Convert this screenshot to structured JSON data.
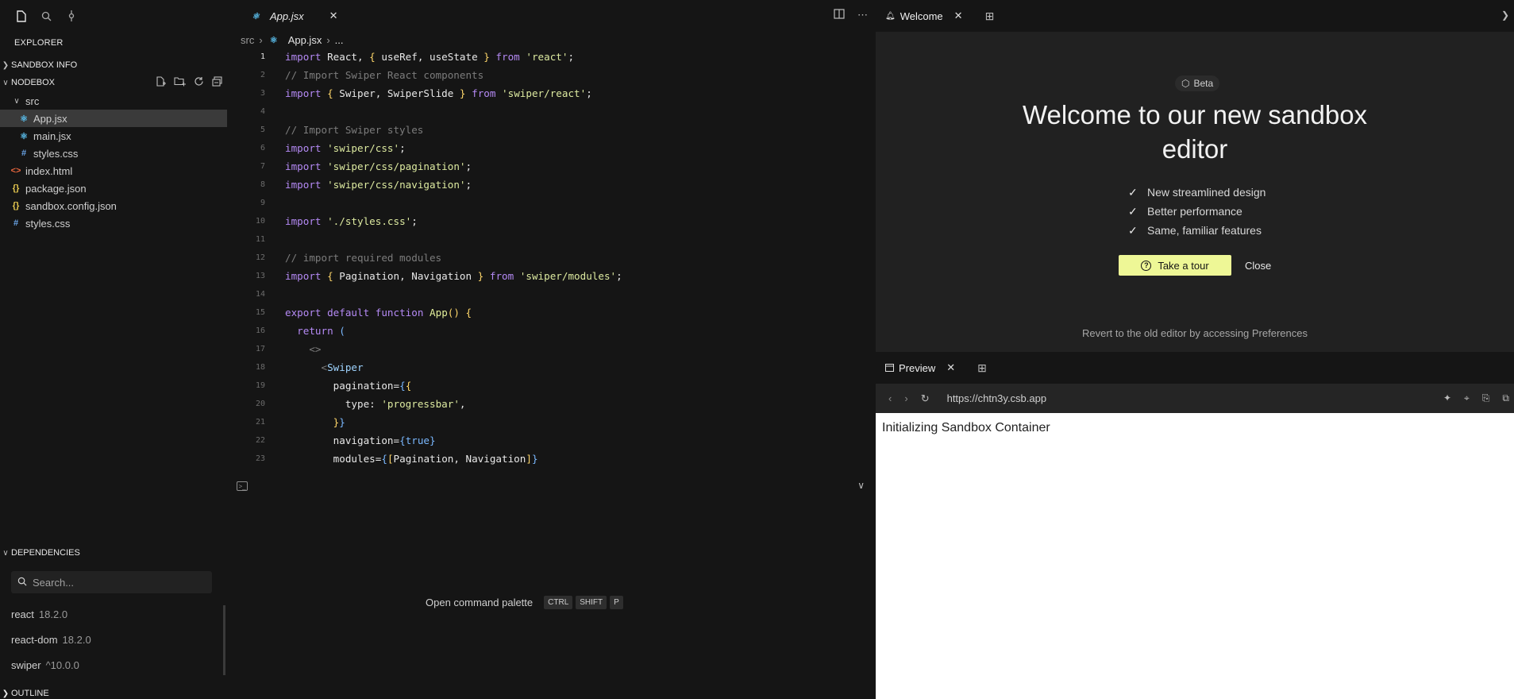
{
  "sidebar": {
    "explorer_title": "EXPLORER",
    "sandbox_info": "SANDBOX INFO",
    "nodebox": "NODEBOX",
    "files": [
      {
        "name": "src",
        "type": "folder",
        "icon": "chevron-down-icon"
      },
      {
        "name": "App.jsx",
        "type": "react",
        "icon": "react-icon"
      },
      {
        "name": "main.jsx",
        "type": "react",
        "icon": "react-icon"
      },
      {
        "name": "styles.css",
        "type": "css",
        "icon": "hash-icon"
      },
      {
        "name": "index.html",
        "type": "html",
        "icon": "html-icon"
      },
      {
        "name": "package.json",
        "type": "json",
        "icon": "braces-icon"
      },
      {
        "name": "sandbox.config.json",
        "type": "json",
        "icon": "braces-icon"
      },
      {
        "name": "styles.css",
        "type": "css",
        "icon": "hash-icon"
      }
    ],
    "dependencies_title": "DEPENDENCIES",
    "search_placeholder": "Search...",
    "dependencies": [
      {
        "name": "react",
        "version": "18.2.0"
      },
      {
        "name": "react-dom",
        "version": "18.2.0"
      },
      {
        "name": "swiper",
        "version": "^10.0.0"
      }
    ],
    "outline_title": "OUTLINE"
  },
  "editor": {
    "tab_label": "App.jsx",
    "breadcrumb": [
      "src",
      "App.jsx",
      "..."
    ],
    "palette_label": "Open command palette",
    "palette_keys": [
      "CTRL",
      "SHIFT",
      "P"
    ]
  },
  "code_lines": [
    {
      "n": "1",
      "html": "<span class='kw'>import</span> React, <span class='br'>{</span> useRef, useState <span class='br'>}</span> <span class='kw'>from</span> <span class='str'>'react'</span>;"
    },
    {
      "n": "2",
      "html": "<span class='cm'>// Import Swiper React components</span>"
    },
    {
      "n": "3",
      "html": "<span class='kw'>import</span> <span class='br'>{</span> Swiper, SwiperSlide <span class='br'>}</span> <span class='kw'>from</span> <span class='str'>'swiper/react'</span>;"
    },
    {
      "n": "4",
      "html": ""
    },
    {
      "n": "5",
      "html": "<span class='cm'>// Import Swiper styles</span>"
    },
    {
      "n": "6",
      "html": "<span class='kw'>import</span> <span class='str'>'swiper/css'</span>;"
    },
    {
      "n": "7",
      "html": "<span class='kw'>import</span> <span class='str'>'swiper/css/pagination'</span>;"
    },
    {
      "n": "8",
      "html": "<span class='kw'>import</span> <span class='str'>'swiper/css/navigation'</span>;"
    },
    {
      "n": "9",
      "html": ""
    },
    {
      "n": "10",
      "html": "<span class='kw'>import</span> <span class='str'>'./styles.css'</span>;"
    },
    {
      "n": "11",
      "html": ""
    },
    {
      "n": "12",
      "html": "<span class='cm'>// import required modules</span>"
    },
    {
      "n": "13",
      "html": "<span class='kw'>import</span> <span class='br'>{</span> Pagination, Navigation <span class='br'>}</span> <span class='kw'>from</span> <span class='str'>'swiper/modules'</span>;"
    },
    {
      "n": "14",
      "html": ""
    },
    {
      "n": "15",
      "html": "<span class='kw'>export</span> <span class='kw'>default</span> <span class='kw'>function</span> <span class='fn'>App</span><span class='br'>()</span> <span class='br'>{</span>"
    },
    {
      "n": "16",
      "html": "  <span class='kw'>return</span> <span class='br2'>(</span>"
    },
    {
      "n": "17",
      "html": "    <span class='cm'>&lt;&gt;</span>"
    },
    {
      "n": "18",
      "html": "      <span class='cm'>&lt;</span><span class='tag'>Swiper</span>"
    },
    {
      "n": "19",
      "html": "        <span class='attr'>pagination</span>=<span class='br2'>{</span><span class='br'>{</span>"
    },
    {
      "n": "20",
      "html": "          type: <span class='str'>'progressbar'</span>,"
    },
    {
      "n": "21",
      "html": "        <span class='br'>}</span><span class='br2'>}</span>"
    },
    {
      "n": "22",
      "html": "        <span class='attr'>navigation</span>=<span class='br2'>{</span><span class='br2'>true</span><span class='br2'>}</span>"
    },
    {
      "n": "23",
      "html": "        <span class='attr'>modules</span>=<span class='br2'>{</span><span class='br'>[</span>Pagination, Navigation<span class='br'>]</span><span class='br2'>}</span>"
    }
  ],
  "welcome": {
    "tab_label": "Welcome",
    "badge": "Beta",
    "title": "Welcome to our new sandbox editor",
    "features": [
      "New streamlined design",
      "Better performance",
      "Same, familiar features"
    ],
    "tour_button": "Take a tour",
    "close_button": "Close",
    "revert_text": "Revert to the old editor by accessing Preferences"
  },
  "preview": {
    "tab_label": "Preview",
    "url": "https://chtn3y.csb.app",
    "body_text": "Initializing Sandbox Container"
  },
  "colors": {
    "accent": "#eef796",
    "background": "#151515",
    "panel": "#212121"
  }
}
